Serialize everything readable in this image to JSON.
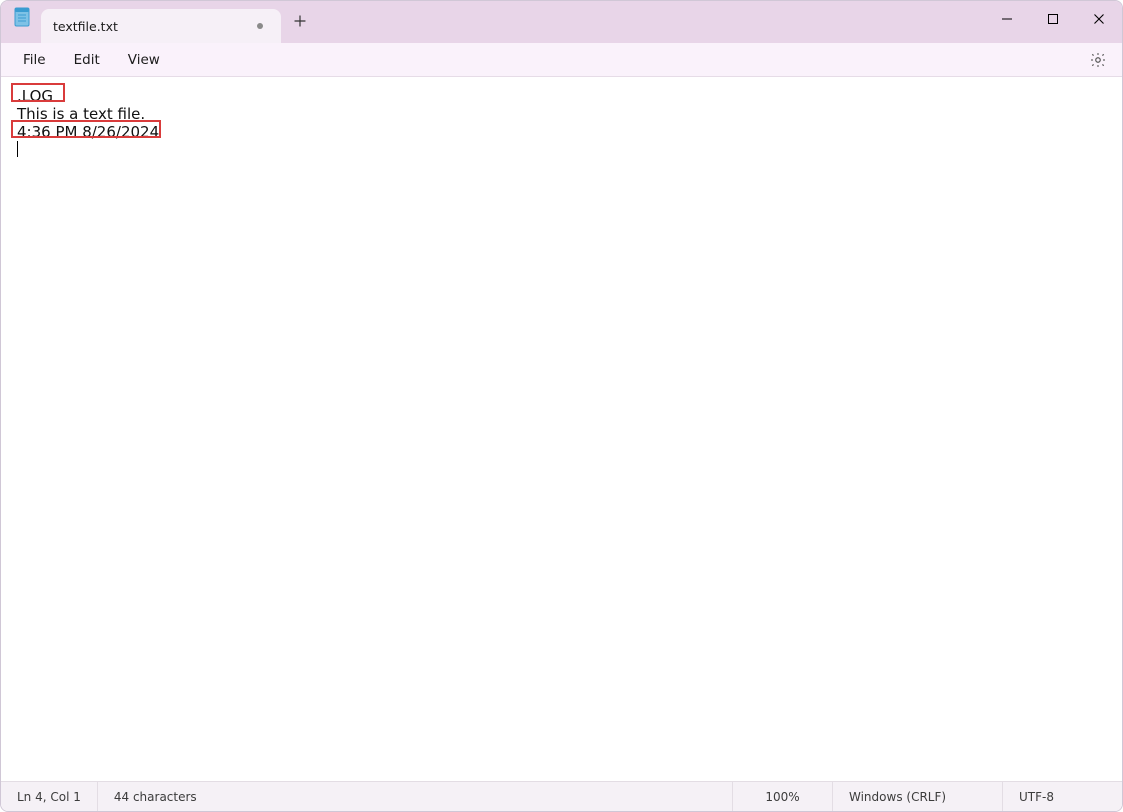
{
  "titlebar": {
    "tab_title": "textfile.txt",
    "modified": true
  },
  "menu": {
    "file": "File",
    "edit": "Edit",
    "view": "View"
  },
  "editor": {
    "lines": {
      "l1": ".LOG",
      "l2": "This is a text file.",
      "l3": "4:36 PM 8/26/2024",
      "l4": ""
    }
  },
  "status": {
    "cursor_position": "Ln 4, Col 1",
    "char_count": "44 characters",
    "zoom": "100%",
    "line_ending": "Windows (CRLF)",
    "encoding": "UTF-8"
  }
}
